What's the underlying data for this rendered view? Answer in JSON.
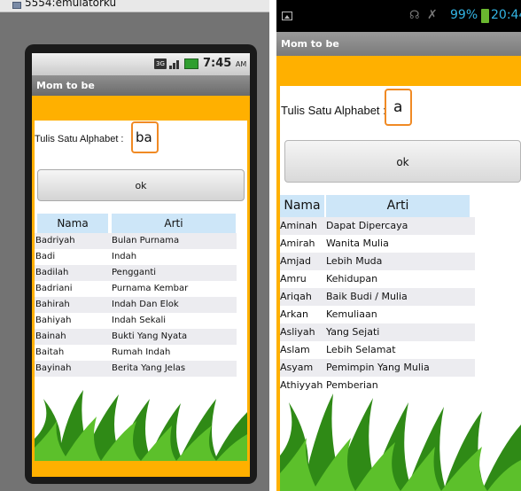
{
  "emulator": {
    "window_title": "5554:emulatorku",
    "status_time": "7:45",
    "status_ampm": "AM",
    "status_3g": "3G",
    "app_title": "Mom to be",
    "input_label": "Tulis Satu Alphabet :",
    "input_value": "ba",
    "ok_label": "ok",
    "table": {
      "headers": [
        "Nama",
        "Arti"
      ],
      "rows": [
        [
          "Badriyah",
          "Bulan Purnama"
        ],
        [
          "Badi",
          "Indah"
        ],
        [
          "Badilah",
          "Pengganti"
        ],
        [
          "Badriani",
          "Purnama Kembar"
        ],
        [
          "Bahirah",
          "Indah Dan Elok"
        ],
        [
          "Bahiyah",
          "Indah Sekali"
        ],
        [
          "Bainah",
          "Bukti Yang Nyata"
        ],
        [
          "Baitah",
          "Rumah Indah"
        ],
        [
          "Bayinah",
          "Berita Yang Jelas"
        ]
      ]
    }
  },
  "device": {
    "battery_pct": "99%",
    "status_time": "20:44",
    "app_title": "Mom to be",
    "input_label": "Tulis Satu Alphabet :",
    "input_value": "a",
    "ok_label": "ok",
    "table": {
      "headers": [
        "Nama",
        "Arti"
      ],
      "rows": [
        [
          "Aminah",
          "Dapat Dipercaya"
        ],
        [
          "Amirah",
          "Wanita Mulia"
        ],
        [
          "Amjad",
          "Lebih Muda"
        ],
        [
          "Amru",
          "Kehidupan"
        ],
        [
          "Ariqah",
          "Baik Budi / Mulia"
        ],
        [
          "Arkan",
          "Kemuliaan"
        ],
        [
          "Asliyah",
          "Yang Sejati"
        ],
        [
          "Aslam",
          "Lebih Selamat"
        ],
        [
          "Asyam",
          "Pemimpin Yang Mulia"
        ],
        [
          "Athiyyah",
          "Pemberian"
        ]
      ]
    }
  },
  "colors": {
    "accent": "#ffb000",
    "header_cell": "#cde6f8",
    "input_border": "#f08a24",
    "status_blue": "#33b5e5",
    "grass": "#3c9a1e"
  }
}
